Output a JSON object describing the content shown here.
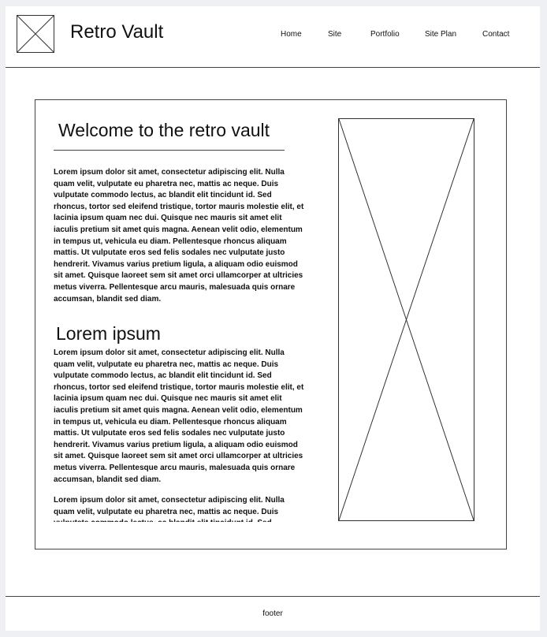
{
  "header": {
    "site_title": "Retro Vault",
    "logo_icon": "image-placeholder-icon",
    "nav": [
      {
        "label": "Home"
      },
      {
        "label": "Site"
      },
      {
        "label": "Portfolio"
      },
      {
        "label": "Site Plan"
      },
      {
        "label": "Contact"
      }
    ]
  },
  "main": {
    "heading": "Welcome to the retro vault",
    "intro": "Lorem ipsum dolor sit amet, consectetur adipiscing elit. Nulla quam velit, vulputate eu pharetra nec, mattis ac neque. Duis vulputate commodo lectus, ac blandit elit tincidunt id. Sed rhoncus, tortor sed eleifend tristique, tortor mauris molestie elit, et lacinia ipsum quam nec dui. Quisque nec mauris sit amet elit iaculis pretium sit amet quis magna. Aenean velit odio, elementum in tempus ut, vehicula eu diam. Pellentesque rhoncus aliquam mattis. Ut vulputate eros sed felis sodales nec vulputate justo hendrerit. Vivamus varius pretium ligula, a aliquam odio euismod sit amet. Quisque laoreet sem sit amet orci ullamcorper at ultricies metus viverra. Pellentesque arcu mauris, malesuada quis ornare accumsan, blandit sed diam.",
    "subheading": "Lorem ipsum",
    "body": "Lorem ipsum dolor sit amet, consectetur adipiscing elit. Nulla quam velit, vulputate eu pharetra nec, mattis ac neque. Duis vulputate commodo lectus, ac blandit elit tincidunt id. Sed rhoncus, tortor sed eleifend tristique, tortor mauris molestie elit, et lacinia ipsum quam nec dui. Quisque nec mauris sit amet elit iaculis pretium sit amet quis magna. Aenean velit odio, elementum in tempus ut, vehicula eu diam. Pellentesque rhoncus aliquam mattis. Ut vulputate eros sed felis sodales nec vulputate justo hendrerit. Vivamus varius pretium ligula, a aliquam odio euismod sit amet. Quisque laoreet sem sit amet orci ullamcorper at ultricies metus viverra. Pellentesque arcu mauris, malesuada quis ornare accumsan, blandit sed diam.",
    "body_more": "Lorem ipsum dolor sit amet, consectetur adipiscing elit. Nulla quam velit, vulputate eu pharetra nec, mattis ac neque. Duis vulputate commodo lectus, ac blandit elit tincidunt id. Sed",
    "image_icon": "image-placeholder-icon"
  },
  "footer": {
    "text": "footer"
  }
}
